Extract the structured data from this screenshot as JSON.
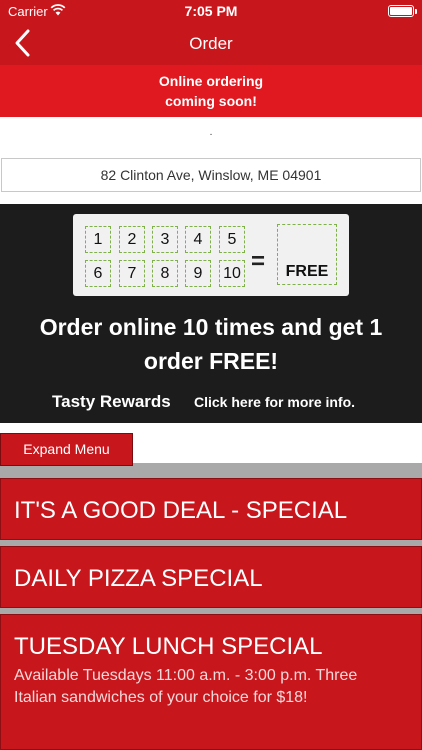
{
  "status_bar": {
    "carrier": "Carrier",
    "time": "7:05 PM"
  },
  "nav": {
    "title": "Order"
  },
  "notice": {
    "line1": "Online ordering",
    "line2": "coming soon!"
  },
  "dot": ".",
  "address": "82 Clinton Ave, Winslow, ME 04901",
  "rewards": {
    "punch_numbers": [
      "1",
      "2",
      "3",
      "4",
      "5",
      "6",
      "7",
      "8",
      "9",
      "10"
    ],
    "equals": "=",
    "free_label": "FREE",
    "promo_line1": "Order online 10 times and get 1",
    "promo_line2": "order FREE!",
    "title": "Tasty Rewards",
    "link": "Click here for more info."
  },
  "expand_menu_label": "Expand Menu",
  "menu_items": [
    {
      "title": "IT'S A GOOD DEAL - SPECIAL"
    },
    {
      "title": "DAILY PIZZA SPECIAL"
    },
    {
      "title": "TUESDAY LUNCH SPECIAL",
      "desc_line1": "Available Tuesdays 11:00 a.m. - 3:00 p.m. Three",
      "desc_line2": "Italian sandwiches of your choice for $18!"
    }
  ],
  "colors": {
    "brand_red": "#c8161d",
    "notice_red": "#e0181f",
    "dark_panel": "#1c1c1c",
    "dashed_green": "#7fb04a"
  }
}
